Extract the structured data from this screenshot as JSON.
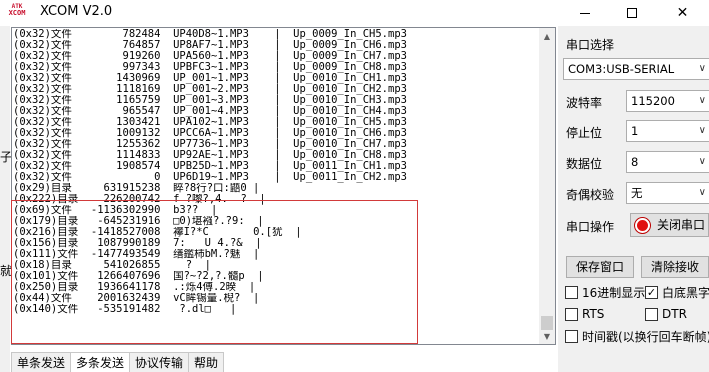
{
  "window": {
    "logo_line1": "ATK",
    "logo_line2": "XCOM",
    "title": "XCOM V2.0",
    "min_label": "",
    "max_label": "",
    "close_label": "✕"
  },
  "left_strip": {
    "chars": [
      "子",
      "就"
    ]
  },
  "log": {
    "lines": [
      "(0x32)文件        782484  UP40D8~1.MP3    |  Up_0009_In_CH5.mp3",
      "(0x32)文件        764857  UP8AF7~1.MP3    |  Up_0009_In_CH6.mp3",
      "(0x32)文件        919260  UPA560~1.MP3    |  Up_0009_In_CH7.mp3",
      "(0x32)文件        997343  UPBFC3~1.MP3    |  Up_0009_In_CH8.mp3",
      "(0x32)文件       1430969  UP_001~1.MP3    |  Up_0010_In_CH1.mp3",
      "(0x32)文件       1118169  UP_001~2.MP3    |  Up_0010_In_CH2.mp3",
      "(0x32)文件       1165759  UP_001~3.MP3    |  Up_0010_In_CH3.mp3",
      "(0x32)文件        965547  UP_001~4.MP3    |  Up_0010_In_CH4.mp3",
      "(0x32)文件       1303421  UPA102~1.MP3    |  Up_0010_In_CH5.mp3",
      "(0x32)文件       1009132  UPCC6A~1.MP3    |  Up_0010_In_CH6.mp3",
      "(0x32)文件       1255362  UP7736~1.MP3    |  Up_0010_In_CH7.mp3",
      "(0x32)文件       1114833  UP92AE~1.MP3    |  Up_0010_In_CH8.mp3",
      "(0x32)文件       1908574  UPB25D~1.MP3    |  Up_0011_In_CH1.mp3",
      "(0x32)文件             0  UP6D19~1.MP3    |  Up_0011_In_CH2.mp3",
      "(0x29)目录     631915238  睟?8行?口:鼯0 |",
      "(0x222)目录    226200742  f ?嚟?,4.  ?  |",
      "(0x69)文件   -1136302990  b3??  |",
      "(0x179)目录   -645231916  □0)堪襁?.?9:  |",
      "(0x216)目录  -1418527008  襻I?*C       0.[犹  |",
      "(0x156)目录   1087990189  7:   U 4.?&  |",
      "(0x111)文件  -1477493549  缮鑑柿bM.?魅  |",
      "(0x18)目录     541026855    ?  |",
      "(0x101)文件   1266407696  国?~?2,?.髓p  |",
      "(0x250)目录   1936641178  .:烁4傅.2暌  |",
      "(0x44)文件    2001632439  vC眸锡量.棿?  |",
      "(0x140)文件   -535191482   ?.dl□   |"
    ]
  },
  "scrollbar": {
    "up_icon": "▲",
    "down_icon": "▼"
  },
  "tabs": [
    "单条发送",
    "多条发送",
    "协议传输",
    "帮助"
  ],
  "panel": {
    "port_select_label": "串口选择",
    "port_value": "COM3:USB-SERIAL",
    "baud_label": "波特率",
    "baud_value": "115200",
    "stop_label": "停止位",
    "stop_value": "1",
    "data_label": "数据位",
    "data_value": "8",
    "parity_label": "奇偶校验",
    "parity_value": "无",
    "port_op_label": "串口操作",
    "close_port_button": "关闭串口",
    "save_window_button": "保存窗口",
    "clear_recv_button": "清除接收",
    "hex_display_label": "16进制显示",
    "hex_display_checked": false,
    "white_bg_label": "白底黑字",
    "white_bg_checked": true,
    "rts_label": "RTS",
    "rts_checked": false,
    "dtr_label": "DTR",
    "dtr_checked": false,
    "timestamp_label": "时间戳(以换行回车断帧)",
    "timestamp_checked": false,
    "dropdown_icon": "∨",
    "led_color": "#e01010"
  }
}
